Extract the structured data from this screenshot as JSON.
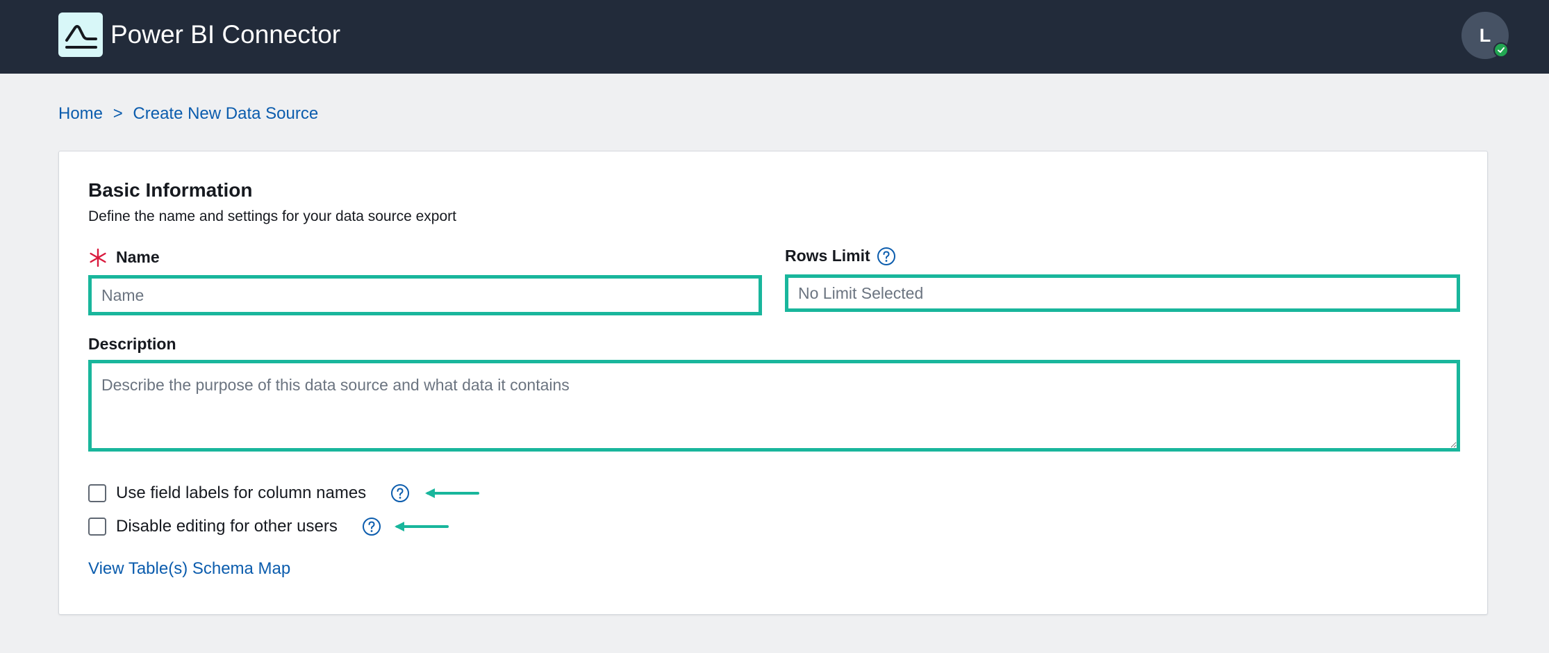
{
  "header": {
    "app_title": "Power BI Connector",
    "logo_icon": "connector-logo-icon",
    "avatar_initial": "L",
    "avatar_status_icon": "check-icon"
  },
  "breadcrumb": {
    "home": "Home",
    "separator": ">",
    "current": "Create New Data Source"
  },
  "form": {
    "section_title": "Basic Information",
    "section_description": "Define the name and settings for your data source export",
    "name_label": "Name",
    "name_placeholder": "Name",
    "rows_limit_label": "Rows Limit",
    "rows_limit_placeholder": "No Limit Selected",
    "description_label": "Description",
    "description_placeholder": "Describe the purpose of this data source and what data it contains",
    "checkbox_field_labels": "Use field labels for column names",
    "checkbox_disable_editing": "Disable editing for other users",
    "schema_link": "View Table(s) Schema Map"
  },
  "colors": {
    "header_bg": "#222b3a",
    "accent_teal": "#19b69c",
    "link_blue": "#0b5cad",
    "required_red": "#d91a3d"
  }
}
